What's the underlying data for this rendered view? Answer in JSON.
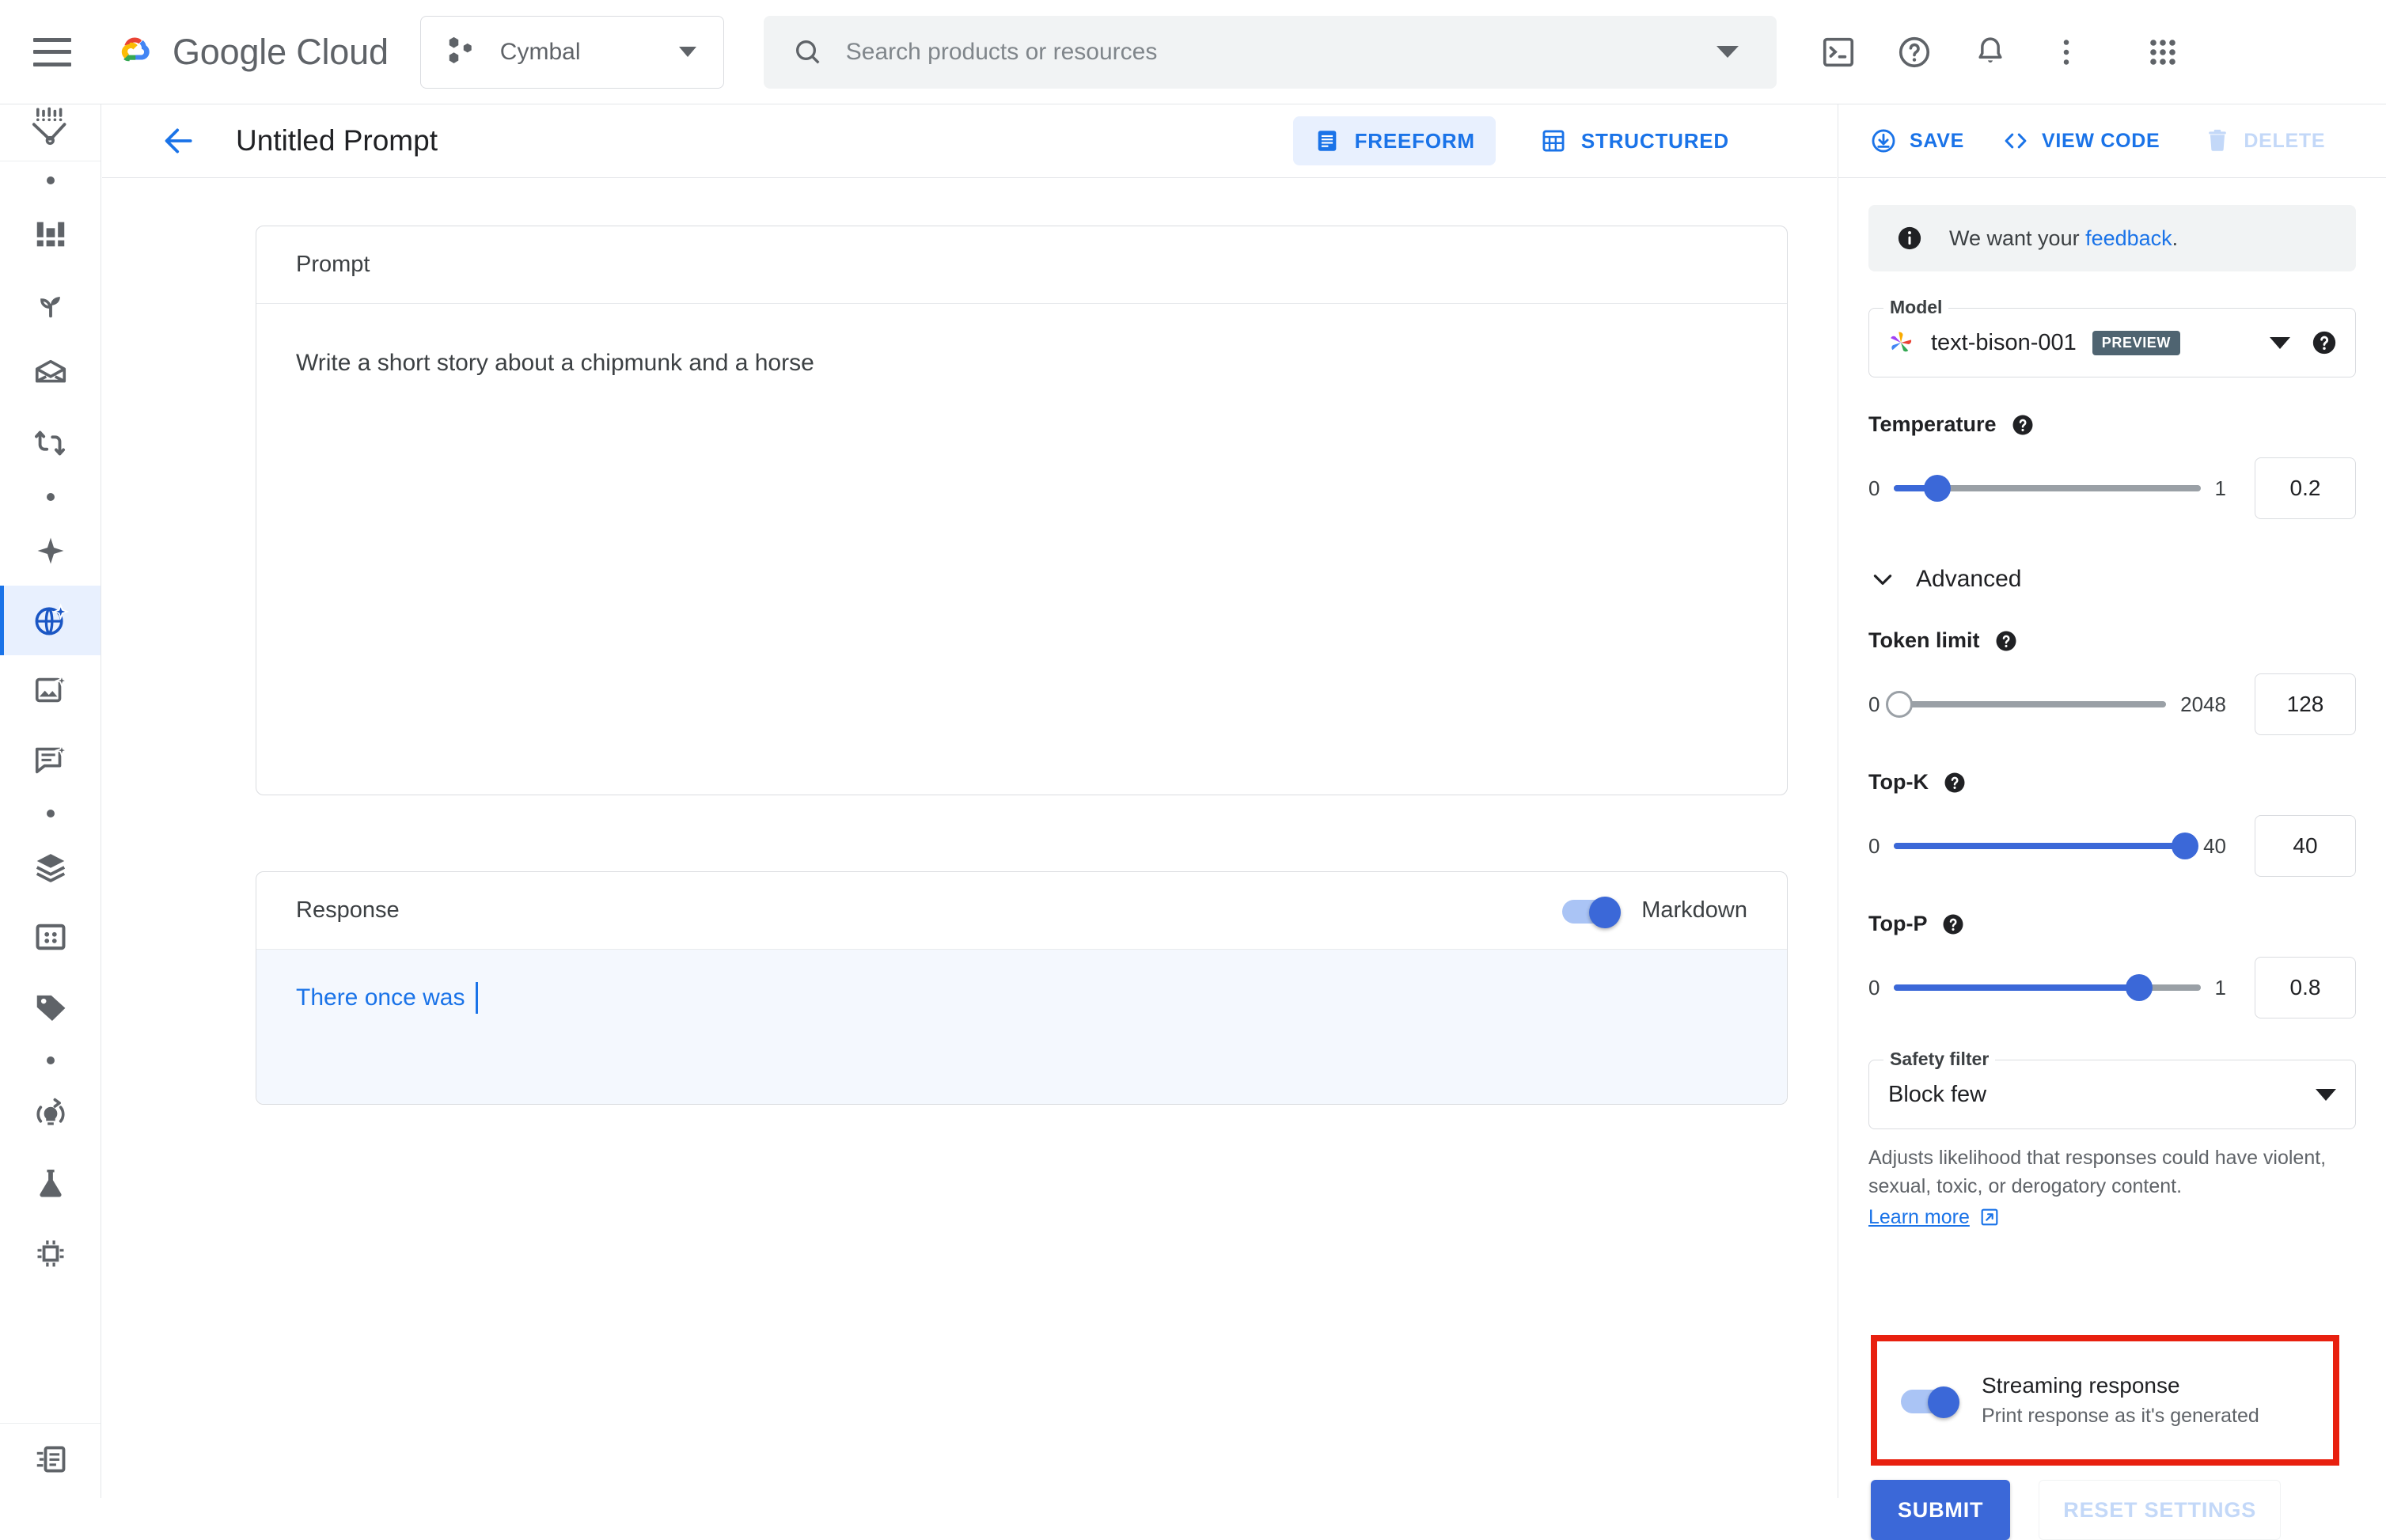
{
  "topbar": {
    "menu_icon": "hamburger-menu-icon",
    "brand": "Google Cloud",
    "project": {
      "name": "Cymbal",
      "icon": "project-hexagons-icon"
    },
    "search": {
      "placeholder": "Search products or resources",
      "value": "",
      "icon": "search-icon"
    },
    "actions": [
      {
        "name": "cloud-shell-icon",
        "label": "Cloud Shell"
      },
      {
        "name": "help-icon",
        "label": "Help"
      },
      {
        "name": "notifications-bell-icon",
        "label": "Notifications"
      },
      {
        "name": "more-vert-icon",
        "label": "More options"
      },
      {
        "name": "apps-grid-icon",
        "label": "Google apps"
      }
    ]
  },
  "rail": {
    "logo_icon": "vertex-ai-logo-icon",
    "items": [
      {
        "icon": "dot-separator",
        "label": "",
        "active": false,
        "separator": true
      },
      {
        "icon": "dashboard-icon",
        "label": "Dashboard",
        "active": false
      },
      {
        "icon": "sprout-icon",
        "label": "Training",
        "active": false
      },
      {
        "icon": "datasets-icon",
        "label": "Datasets",
        "active": false
      },
      {
        "icon": "pipelines-icon",
        "label": "Pipelines",
        "active": false
      },
      {
        "icon": "dot-separator",
        "label": "",
        "active": false,
        "separator": true
      },
      {
        "icon": "sparkle-icon",
        "label": "Generative AI Studio",
        "active": false
      },
      {
        "icon": "language-sparkle-icon",
        "label": "Language",
        "active": true
      },
      {
        "icon": "image-sparkle-icon",
        "label": "Vision",
        "active": false
      },
      {
        "icon": "chat-sparkle-icon",
        "label": "Chat",
        "active": false
      },
      {
        "icon": "dot-separator",
        "label": "",
        "active": false,
        "separator": true
      },
      {
        "icon": "layers-icon",
        "label": "Model Registry",
        "active": false
      },
      {
        "icon": "feature-store-icon",
        "label": "Feature Store",
        "active": false
      },
      {
        "icon": "tag-icon",
        "label": "Labeling Tasks",
        "active": false
      },
      {
        "icon": "dot-separator",
        "label": "",
        "active": false,
        "separator": true
      },
      {
        "icon": "lightbulb-refresh-icon",
        "label": "Experiments",
        "active": false
      },
      {
        "icon": "flask-icon",
        "label": "Workbench",
        "active": false
      },
      {
        "icon": "chip-icon",
        "label": "Endpoints",
        "active": false
      }
    ],
    "bottom_item": {
      "icon": "release-notes-icon",
      "label": "Release Notes"
    }
  },
  "page_header": {
    "back_icon": "back-arrow-icon",
    "title": "Untitled Prompt",
    "tabs": [
      {
        "label": "FREEFORM",
        "icon": "freeform-icon",
        "selected": true
      },
      {
        "label": "STRUCTURED",
        "icon": "structured-icon",
        "selected": false
      }
    ]
  },
  "main": {
    "prompt": {
      "header": "Prompt",
      "value": "Write a short story about a chipmunk and a horse"
    },
    "response": {
      "header": "Response",
      "markdown_label": "Markdown",
      "markdown_on": true,
      "text": "There once was"
    }
  },
  "right_panel": {
    "actions": [
      {
        "label": "SAVE",
        "icon": "save-download-icon",
        "disabled": false
      },
      {
        "label": "VIEW CODE",
        "icon": "code-brackets-icon",
        "disabled": false
      },
      {
        "label": "DELETE",
        "icon": "trash-icon",
        "disabled": true
      }
    ],
    "feedback": {
      "prefix": "We want your ",
      "link": "feedback",
      "suffix": ".",
      "icon": "info-icon"
    },
    "model": {
      "legend": "Model",
      "name": "text-bison-001",
      "badge": "PREVIEW",
      "icon": "palm-flower-icon",
      "help_icon": "help-circle-icon"
    },
    "temperature": {
      "label": "Temperature",
      "min": "0",
      "max": "1",
      "value": "0.2",
      "fill_pct": 14,
      "help_icon": "help-circle-icon"
    },
    "advanced": {
      "label": "Advanced",
      "expanded": true,
      "chevron_icon": "chevron-down-icon"
    },
    "token_limit": {
      "label": "Token limit",
      "min": "0",
      "max": "2048",
      "value": "128",
      "fill_pct": 6,
      "help_icon": "help-circle-icon"
    },
    "top_k": {
      "label": "Top-K",
      "min": "0",
      "max": "40",
      "value": "40",
      "fill_pct": 100,
      "help_icon": "help-circle-icon"
    },
    "top_p": {
      "label": "Top-P",
      "min": "0",
      "max": "1",
      "value": "0.8",
      "fill_pct": 80,
      "help_icon": "help-circle-icon"
    },
    "safety_filter": {
      "legend": "Safety filter",
      "value": "Block few",
      "description": "Adjusts likelihood that responses could have violent, sexual, toxic, or derogatory content.",
      "learn_more": "Learn more",
      "external_icon": "open-in-new-icon"
    },
    "streaming": {
      "title": "Streaming response",
      "subtitle": "Print response as it's generated",
      "on": true,
      "highlight_color": "#e8200f"
    },
    "submit_label": "SUBMIT",
    "reset_label": "RESET SETTINGS"
  }
}
